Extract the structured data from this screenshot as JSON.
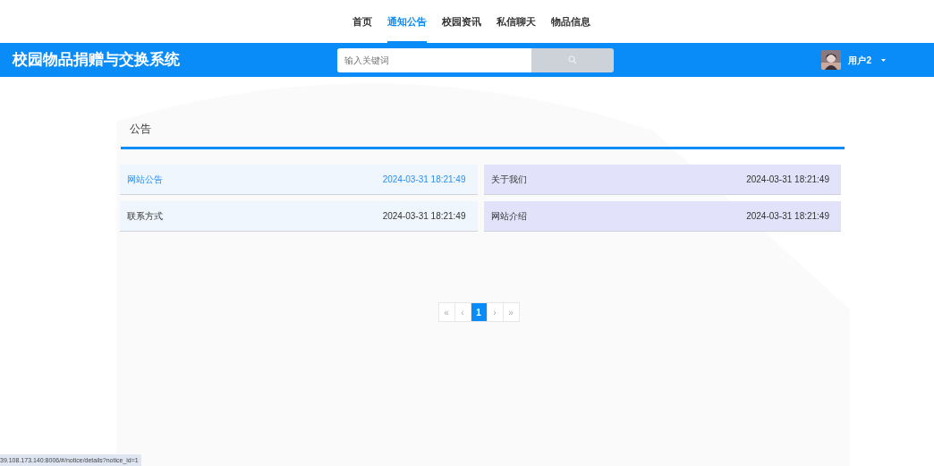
{
  "nav": [
    {
      "label": "首页",
      "selected": false
    },
    {
      "label": "通知公告",
      "selected": true
    },
    {
      "label": "校园资讯",
      "selected": false
    },
    {
      "label": "私信聊天",
      "selected": false
    },
    {
      "label": "物品信息",
      "selected": false
    }
  ],
  "header": {
    "title": "校园物品捐赠与交换系统",
    "search": {
      "placeholder": "输入关键词"
    },
    "user": {
      "name": "用户2"
    }
  },
  "section": {
    "title": "公告"
  },
  "notices": [
    {
      "title": "网站公告",
      "time": "2024-03-31 18:21:49",
      "hovered": true
    },
    {
      "title": "关于我们",
      "time": "2024-03-31 18:21:49",
      "hovered": false
    },
    {
      "title": "联系方式",
      "time": "2024-03-31 18:21:49",
      "hovered": false
    },
    {
      "title": "网站介绍",
      "time": "2024-03-31 18:21:49",
      "hovered": false
    }
  ],
  "pagination": {
    "first": "«",
    "prev": "‹",
    "pages": [
      {
        "label": "1",
        "selected": true
      }
    ],
    "next": "›",
    "last": "»"
  },
  "status_bar": {
    "url": "39.108.173.140:8006/#/notice/details?notice_id=1"
  }
}
